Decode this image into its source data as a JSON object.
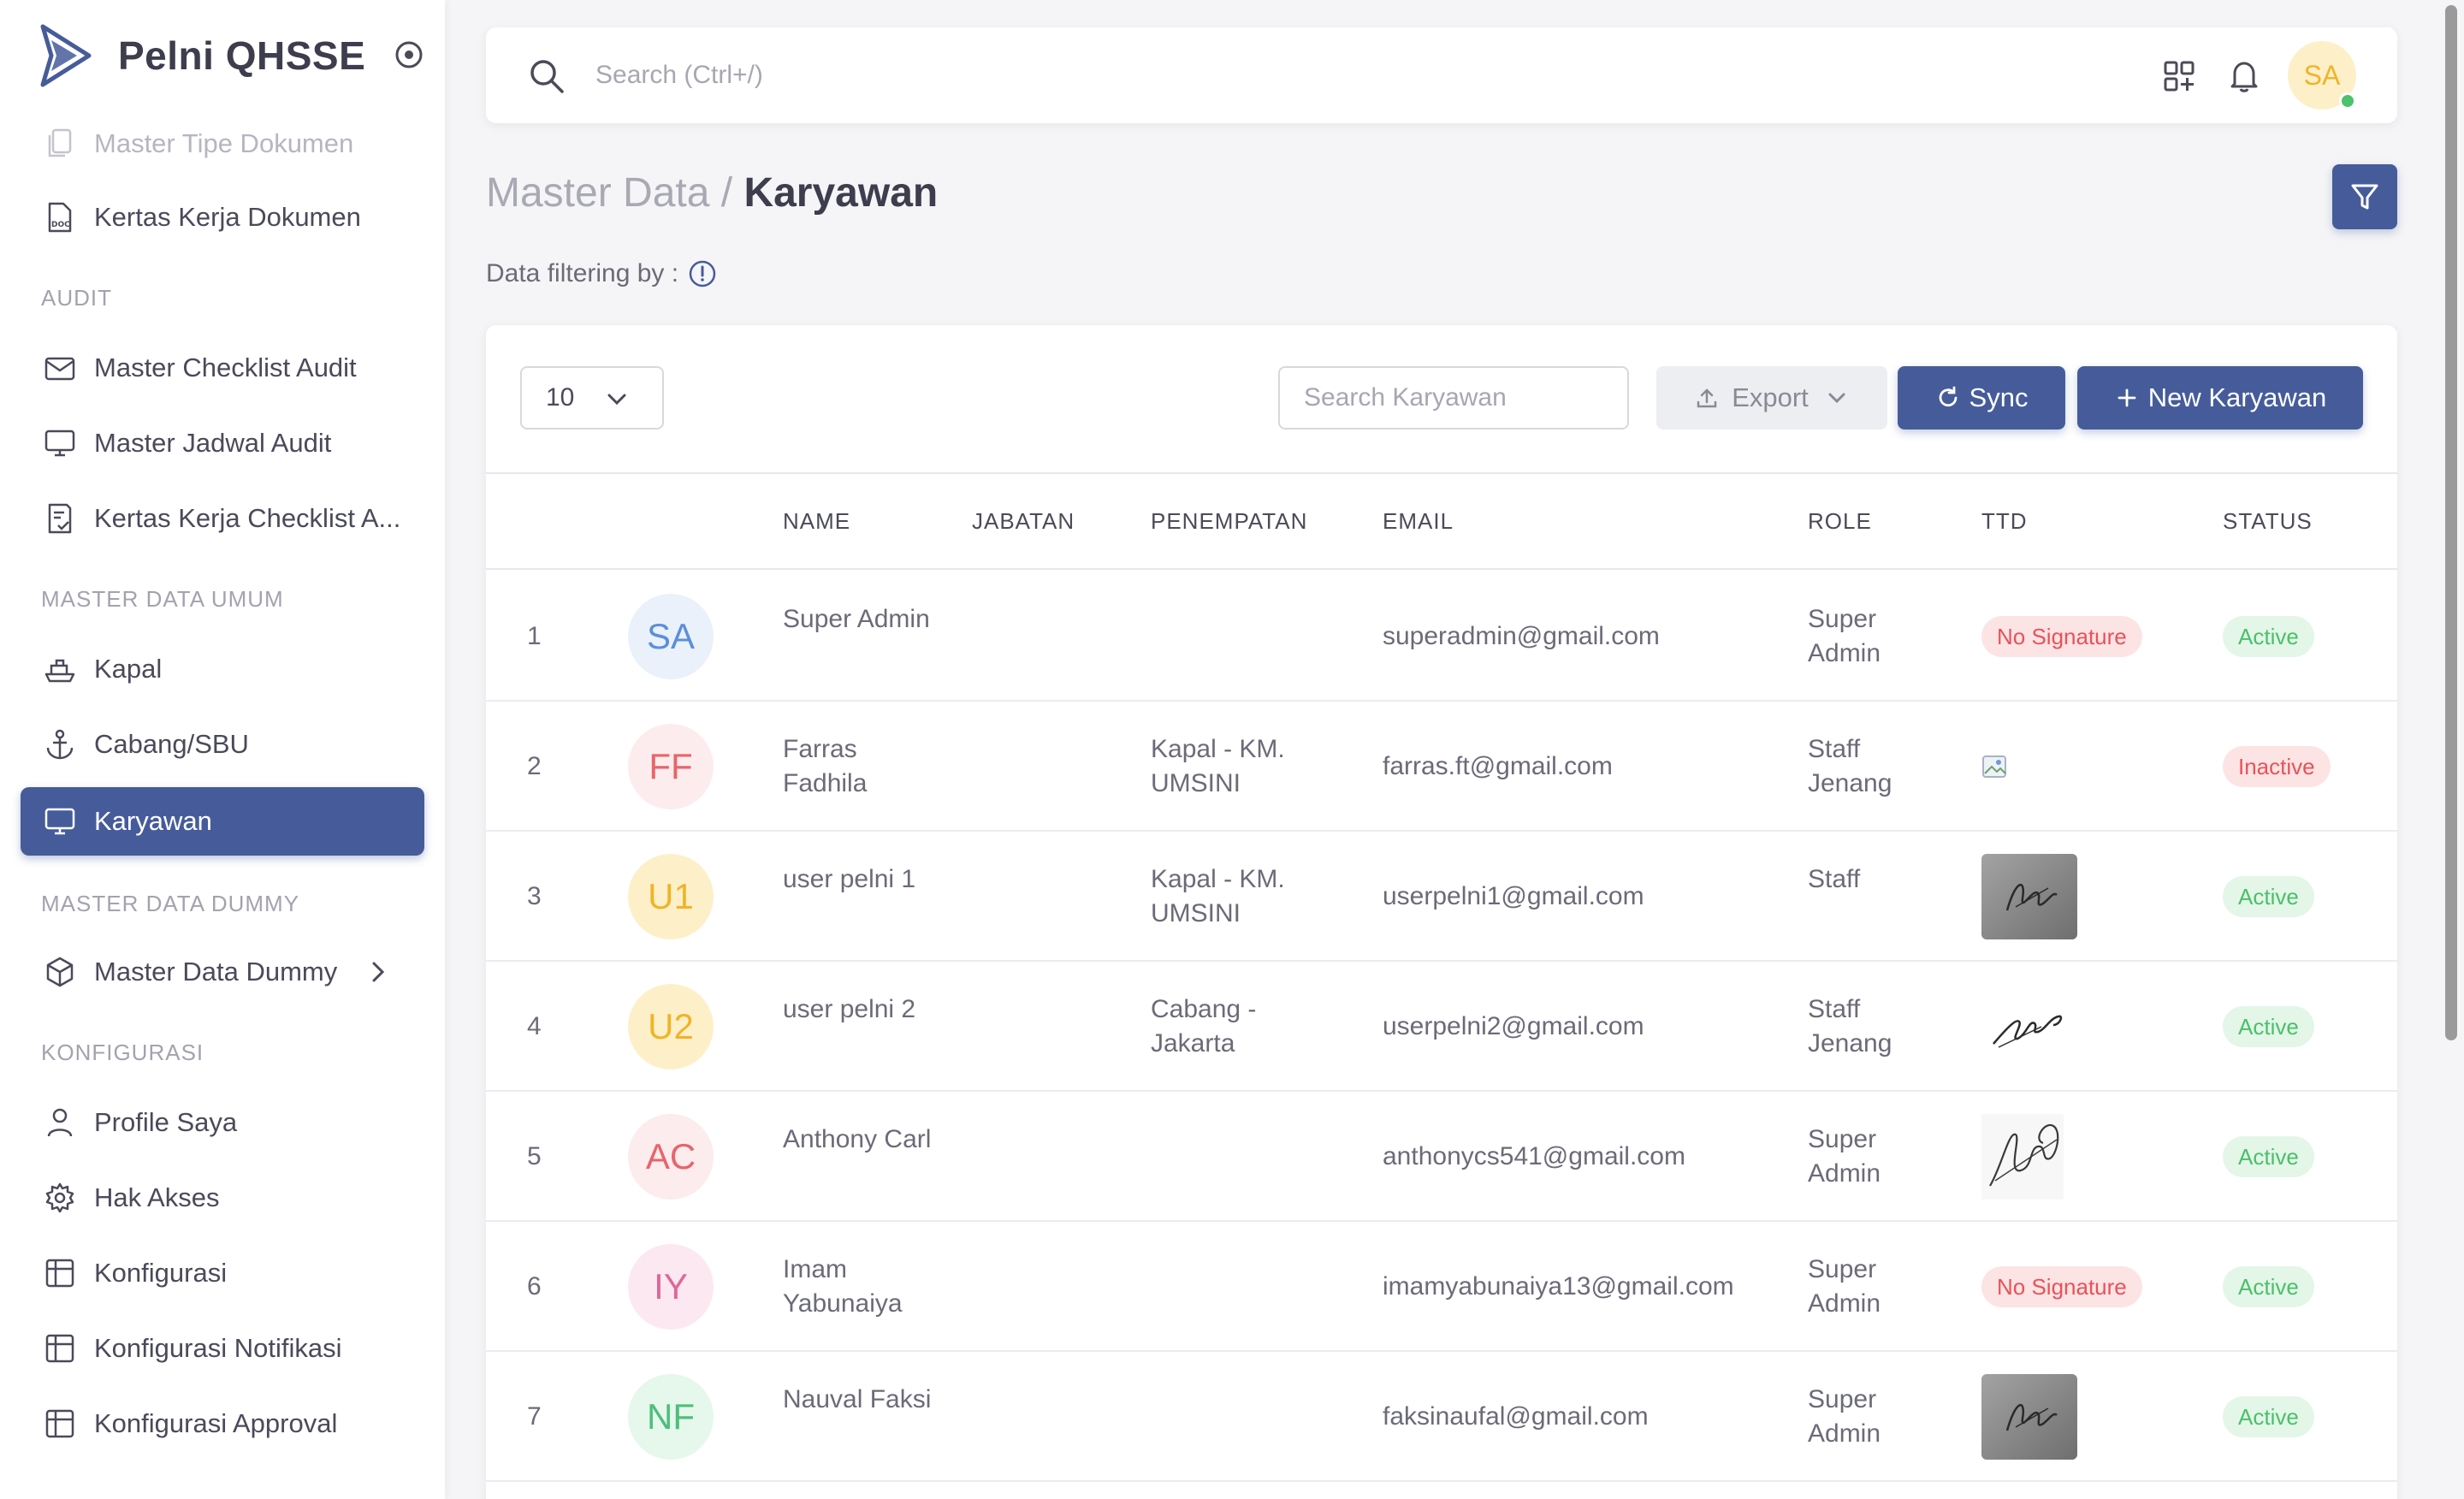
{
  "brand": {
    "name": "Pelni QHSSE",
    "accent": "#465c9a"
  },
  "sidebar": {
    "items_top": [
      {
        "label": "Master Tipe Dokumen",
        "icon": "documents-icon"
      },
      {
        "label": "Kertas Kerja Dokumen",
        "icon": "doc-file-icon"
      }
    ],
    "sections": [
      {
        "title": "AUDIT",
        "items": [
          {
            "label": "Master Checklist Audit",
            "icon": "mail-icon"
          },
          {
            "label": "Master Jadwal Audit",
            "icon": "monitor-icon"
          },
          {
            "label": "Kertas Kerja Checklist A...",
            "icon": "checklist-icon"
          }
        ]
      },
      {
        "title": "MASTER DATA UMUM",
        "items": [
          {
            "label": "Kapal",
            "icon": "ship-icon"
          },
          {
            "label": "Cabang/SBU",
            "icon": "anchor-icon"
          },
          {
            "label": "Karyawan",
            "icon": "monitor-icon",
            "active": true
          }
        ]
      },
      {
        "title": "MASTER DATA DUMMY",
        "items": [
          {
            "label": "Master Data Dummy",
            "icon": "box-icon"
          }
        ]
      },
      {
        "title": "KONFIGURASI",
        "items": [
          {
            "label": "Profile Saya",
            "icon": "user-icon"
          },
          {
            "label": "Hak Akses",
            "icon": "gear-icon"
          },
          {
            "label": "Konfigurasi",
            "icon": "table-icon"
          },
          {
            "label": "Konfigurasi Notifikasi",
            "icon": "table-icon"
          },
          {
            "label": "Konfigurasi Approval",
            "icon": "table-icon"
          }
        ]
      }
    ]
  },
  "topbar": {
    "search_placeholder": "Search (Ctrl+/)",
    "avatar_initials": "SA"
  },
  "page": {
    "breadcrumb_parent": "Master Data",
    "breadcrumb_sep": " / ",
    "title": "Karyawan",
    "filter_label": "Data filtering by :"
  },
  "toolbar": {
    "per_page": "10",
    "search_placeholder": "Search Karyawan",
    "export_label": "Export",
    "sync_label": "Sync",
    "new_label": "New Karyawan"
  },
  "table": {
    "headers": [
      "NAME",
      "JABATAN",
      "PENEMPATAN",
      "EMAIL",
      "ROLE",
      "TTD",
      "STATUS"
    ],
    "rows": [
      {
        "no": "1",
        "initials": "SA",
        "avatar_color": "#5b8fd9",
        "avatar_bg": "#eaf1fb",
        "name": "Super Admin",
        "jabatan": "",
        "penempatan": "",
        "email": "superadmin@gmail.com",
        "role": "Super Admin",
        "ttd": "No Signature",
        "ttd_type": "none",
        "status": "Active"
      },
      {
        "no": "2",
        "initials": "FF",
        "avatar_color": "#e8646b",
        "avatar_bg": "#fdeced",
        "name": "Farras Fadhila",
        "jabatan": "",
        "penempatan": "Kapal - KM. UMSINI",
        "email": "farras.ft@gmail.com",
        "role": "Staff Jenang",
        "ttd": "",
        "ttd_type": "broken",
        "status": "Inactive"
      },
      {
        "no": "3",
        "initials": "U1",
        "avatar_color": "#f0b429",
        "avatar_bg": "#fdf0c9",
        "name": "user pelni 1",
        "jabatan": "",
        "penempatan": "Kapal - KM. UMSINI",
        "email": "userpelni1@gmail.com",
        "role": "Staff",
        "ttd": "",
        "ttd_type": "photo",
        "status": "Active"
      },
      {
        "no": "4",
        "initials": "U2",
        "avatar_color": "#f0b429",
        "avatar_bg": "#fdf0c9",
        "name": "user pelni 2",
        "jabatan": "",
        "penempatan": "Cabang - Jakarta",
        "email": "userpelni2@gmail.com",
        "role": "Staff Jenang",
        "ttd": "",
        "ttd_type": "line",
        "status": "Active"
      },
      {
        "no": "5",
        "initials": "AC",
        "avatar_color": "#e8646b",
        "avatar_bg": "#fdeced",
        "name": "Anthony Carl",
        "jabatan": "",
        "penempatan": "",
        "email": "anthonycs541@gmail.com",
        "role": "Super Admin",
        "ttd": "",
        "ttd_type": "scribble",
        "status": "Active"
      },
      {
        "no": "6",
        "initials": "IY",
        "avatar_color": "#e0669a",
        "avatar_bg": "#fce8f1",
        "name": "Imam Yabunaiya",
        "jabatan": "",
        "penempatan": "",
        "email": "imamyabunaiya13@gmail.com",
        "role": "Super Admin",
        "ttd": "No Signature",
        "ttd_type": "none",
        "status": "Active"
      },
      {
        "no": "7",
        "initials": "NF",
        "avatar_color": "#4cbf7a",
        "avatar_bg": "#e6f7ec",
        "name": "Nauval Faksi",
        "jabatan": "",
        "penempatan": "",
        "email": "faksinaufal@gmail.com",
        "role": "Super Admin",
        "ttd": "",
        "ttd_type": "photo",
        "status": "Active"
      }
    ]
  }
}
